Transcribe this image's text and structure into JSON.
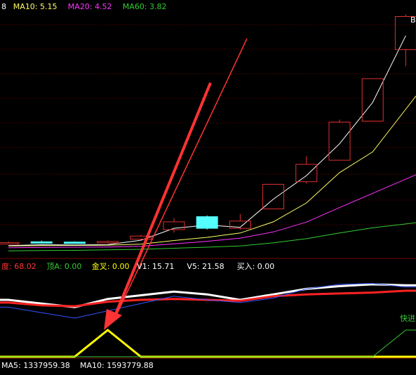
{
  "colors": {
    "background": "#000000",
    "grid": "#7a0000",
    "up_candle": "#e03030",
    "down_candle": "#55ffff",
    "ma5": "#ffffff",
    "ma10": "#ffff66",
    "ma20": "#ff33ff",
    "ma60": "#33cc33",
    "arrow": "#ff3333",
    "yellow": "#ffff00",
    "label_white": "#ffffff",
    "label_yellow": "#ffff00",
    "label_magenta": "#ff33ff",
    "label_green": "#33cc33",
    "label_red": "#ff3333"
  },
  "top_panel": {
    "legend": [
      {
        "text": "8",
        "color": "#ffffff"
      },
      {
        "text": "MA10: 5.15",
        "color": "#ffff66"
      },
      {
        "text": "MA20: 4.52",
        "color": "#ff33ff"
      },
      {
        "text": "MA60: 3.82",
        "color": "#33cc33"
      }
    ],
    "peak_label": "B"
  },
  "middle_panel": {
    "legend": [
      {
        "text": "度: 68.02",
        "color": "#ff3333"
      },
      {
        "text": "顶A: 0.00",
        "color": "#33cc33"
      },
      {
        "text": "金叉: 0.00",
        "color": "#ffff00"
      },
      {
        "text": "V1: 15.71",
        "color": "#ffffff"
      },
      {
        "text": "V5: 21.58",
        "color": "#ffffff"
      },
      {
        "text": "买入: 0.00",
        "color": "#ffffff"
      }
    ],
    "signal_label": "快进"
  },
  "bottom_panel": {
    "legend": [
      {
        "text": "MA5: 1337959.38",
        "color": "#ffffff"
      },
      {
        "text": "MA10: 1593779.88",
        "color": "#ffffff"
      }
    ]
  },
  "chart_data": [
    {
      "type": "candlestick",
      "title": "",
      "candles": [
        {
          "i": 0,
          "open": 3.21,
          "close": 3.25,
          "high": 3.3,
          "low": 3.18,
          "dir": "up"
        },
        {
          "i": 1,
          "open": 3.28,
          "close": 3.25,
          "high": 3.33,
          "low": 3.22,
          "dir": "down"
        },
        {
          "i": 2,
          "open": 3.27,
          "close": 3.24,
          "high": 3.3,
          "low": 3.21,
          "dir": "down"
        },
        {
          "i": 3,
          "open": 3.25,
          "close": 3.29,
          "high": 3.33,
          "low": 3.22,
          "dir": "up"
        },
        {
          "i": 4,
          "open": 3.38,
          "close": 3.5,
          "high": 3.55,
          "low": 3.35,
          "dir": "up"
        },
        {
          "i": 5,
          "open": 3.75,
          "close": 4.05,
          "high": 4.2,
          "low": 3.63,
          "dir": "up"
        },
        {
          "i": 6,
          "open": 4.25,
          "close": 3.8,
          "high": 4.3,
          "low": 3.75,
          "dir": "down"
        },
        {
          "i": 7,
          "open": 3.8,
          "close": 4.08,
          "high": 4.35,
          "low": 3.74,
          "dir": "up"
        },
        {
          "i": 8,
          "open": 4.55,
          "close": 5.5,
          "high": 5.5,
          "low": 4.55,
          "dir": "up"
        },
        {
          "i": 9,
          "open": 5.6,
          "close": 6.27,
          "high": 6.58,
          "low": 5.53,
          "dir": "up"
        },
        {
          "i": 10,
          "open": 6.43,
          "close": 7.9,
          "high": 8.0,
          "low": 6.43,
          "dir": "up"
        },
        {
          "i": 11,
          "open": 7.94,
          "close": 9.58,
          "high": 9.58,
          "low": 7.94,
          "dir": "up"
        },
        {
          "i": 12,
          "open": 10.7,
          "close": 11.98,
          "high": 12.06,
          "low": 10.06,
          "dir": "up"
        }
      ],
      "moving_averages": [
        {
          "name": "MA10",
          "values": [
            3.12,
            3.13,
            3.14,
            3.15,
            3.19,
            3.33,
            3.45,
            3.62,
            4.05,
            4.78,
            5.95,
            6.75,
            8.4
          ]
        },
        {
          "name": "MA20",
          "values": [
            3.05,
            3.06,
            3.07,
            3.08,
            3.11,
            3.2,
            3.3,
            3.42,
            3.66,
            4.04,
            4.6,
            5.15,
            5.7
          ]
        },
        {
          "name": "MA60",
          "values": [
            2.93,
            2.94,
            2.95,
            2.97,
            2.99,
            3.03,
            3.07,
            3.12,
            3.24,
            3.4,
            3.62,
            3.82,
            3.97
          ]
        }
      ],
      "ylim": [
        2.8,
        12.4
      ]
    },
    {
      "type": "line",
      "title": "",
      "x": [
        0,
        1,
        2,
        3,
        4,
        5,
        6,
        7,
        8,
        9,
        10,
        11,
        12
      ],
      "series": [
        {
          "values": [
            60,
            56,
            52,
            61,
            65,
            69,
            66,
            60,
            66,
            72,
            75,
            77,
            76
          ]
        },
        {
          "values": [
            57,
            54,
            53,
            58,
            60,
            61,
            60,
            59,
            64,
            66,
            67,
            68,
            70
          ]
        },
        {
          "values": [
            52,
            46,
            40,
            48,
            56,
            64,
            60,
            57,
            62,
            72,
            77,
            78,
            74
          ]
        }
      ],
      "ylim": [
        0,
        100
      ]
    },
    {
      "type": "line",
      "title": "",
      "x": [
        0,
        1,
        2,
        3,
        4,
        5,
        6,
        7,
        8,
        9,
        10,
        11,
        12
      ],
      "series": [
        {
          "values": [
            0,
            0,
            0,
            1,
            0,
            0,
            0,
            0,
            0,
            0,
            0,
            0,
            0
          ]
        },
        {
          "values": [
            0,
            0,
            0,
            0,
            0,
            0,
            0,
            0,
            0,
            0,
            0,
            0,
            1
          ]
        }
      ],
      "ylim": [
        0,
        1
      ]
    }
  ]
}
